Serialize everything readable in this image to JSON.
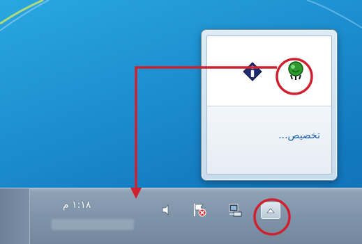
{
  "flyout": {
    "icons": [
      "network-status-icon",
      "info-icon"
    ],
    "customize_label": "تخصيص..."
  },
  "taskbar": {
    "clock_time": "١:١٨ م",
    "tray_icons": [
      "speaker-icon",
      "action-center-flag-icon",
      "network-icon"
    ],
    "show_hidden_icon": "chevron-up-icon"
  },
  "colors": {
    "annotation_red": "#d0202e",
    "link_blue": "#1a5fb4",
    "desktop_blue": "#1d8fd0"
  }
}
